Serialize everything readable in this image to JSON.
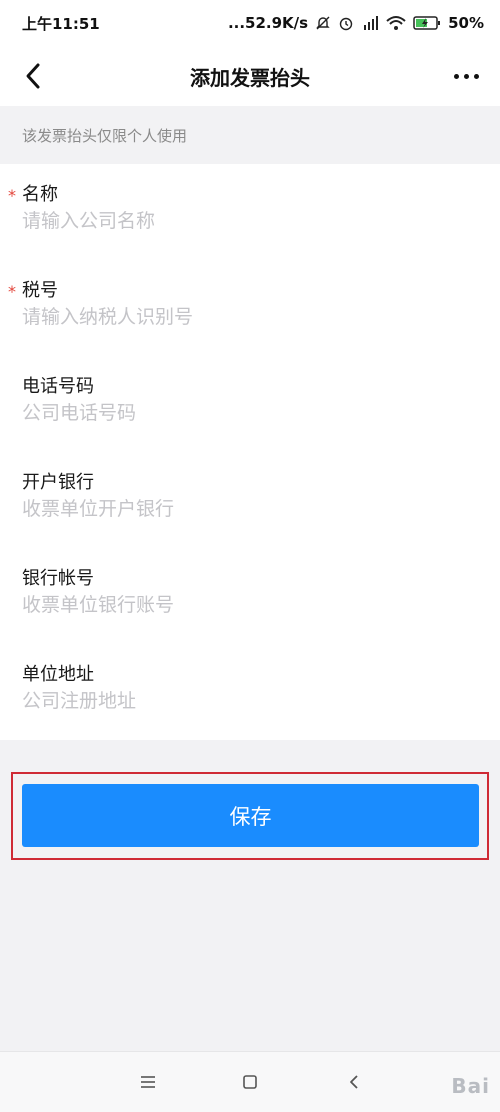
{
  "status_bar": {
    "time": "上午11:51",
    "network_speed": "...52.9K/s",
    "battery_percent": "50%",
    "icons": [
      "mute-bell-icon",
      "alarm-icon",
      "hd-signal-icon",
      "wifi-icon",
      "battery-charging-icon"
    ]
  },
  "nav": {
    "title": "添加发票抬头",
    "back_icon": "chevron-left-icon",
    "more_icon": "more-dots-icon"
  },
  "hint": "该发票抬头仅限个人使用",
  "form": {
    "fields": [
      {
        "label": "名称",
        "placeholder": "请输入公司名称",
        "value": "",
        "required": true
      },
      {
        "label": "税号",
        "placeholder": "请输入纳税人识别号",
        "value": "",
        "required": true
      },
      {
        "label": "电话号码",
        "placeholder": "公司电话号码",
        "value": "",
        "required": false
      },
      {
        "label": "开户银行",
        "placeholder": "收票单位开户银行",
        "value": "",
        "required": false
      },
      {
        "label": "银行帐号",
        "placeholder": "收票单位银行账号",
        "value": "",
        "required": false
      },
      {
        "label": "单位地址",
        "placeholder": "公司注册地址",
        "value": "",
        "required": false
      }
    ],
    "required_mark": "*"
  },
  "save_button": {
    "label": "保存"
  },
  "system_nav": {
    "icons": [
      "menu-icon",
      "home-icon",
      "back-icon"
    ]
  },
  "watermark": {
    "text": "Bai"
  },
  "colors": {
    "accent": "#1a8cfe",
    "required": "#e3463c",
    "highlight_frame": "#cf2a35",
    "placeholder": "#c4c4c8",
    "background": "#f2f2f4"
  }
}
